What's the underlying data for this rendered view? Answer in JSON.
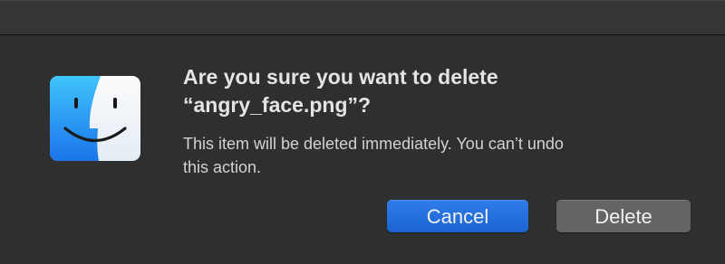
{
  "dialog": {
    "heading_line1": "Are you sure you want to delete",
    "heading_line2": "“angry_face.png”?",
    "message_line1": "This item will be deleted immediately. You can’t undo",
    "message_line2": "this action.",
    "icon": "finder-icon"
  },
  "buttons": {
    "cancel_label": "Cancel",
    "delete_label": "Delete"
  },
  "colors": {
    "background": "#2f2f2f",
    "accent": "#1f6fe0",
    "secondary_button": "#646464"
  }
}
